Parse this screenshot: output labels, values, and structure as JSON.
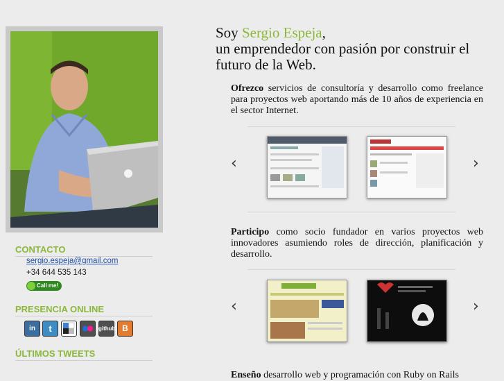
{
  "headline": {
    "prefix": "Soy ",
    "name": "Sergio Espeja",
    "suffix": ",",
    "line2": "un emprendedor con pasión por construir el",
    "line3": "futuro de la Web."
  },
  "sidebar": {
    "contact_title": "CONTACTO",
    "email": "sergio.espeja@gmail.com",
    "phone": "+34 644 535 143",
    "callme_label": "Call me!",
    "presence_title": "PRESENCIA ONLINE",
    "social": [
      {
        "name": "linkedin-icon",
        "glyph": "in"
      },
      {
        "name": "twitter-icon",
        "glyph": "t"
      },
      {
        "name": "delicious-icon",
        "glyph": ""
      },
      {
        "name": "flickr-icon",
        "glyph": "●●"
      },
      {
        "name": "github-icon",
        "glyph": "github"
      },
      {
        "name": "blogger-icon",
        "glyph": "B"
      }
    ],
    "tweets_title": "ÚLTIMOS TWEETS"
  },
  "sections": {
    "offer_bold": "Ofrezco",
    "offer_text": " servicios de consultoría y desarrollo como freelance para proyectos web aportando más de 10 años de experiencia en el sector Internet.",
    "participate_bold": "Participo",
    "participate_text": " como socio fundador en varios proyectos web innovadores asumiendo roles de dirección, planificación y desarrollo.",
    "teach_bold": "Enseño",
    "teach_text": " desarrollo web y programación con Ruby on Rails"
  },
  "colors": {
    "accent": "#8bb83a",
    "link": "#1f4fa8",
    "background": "#ececec"
  }
}
